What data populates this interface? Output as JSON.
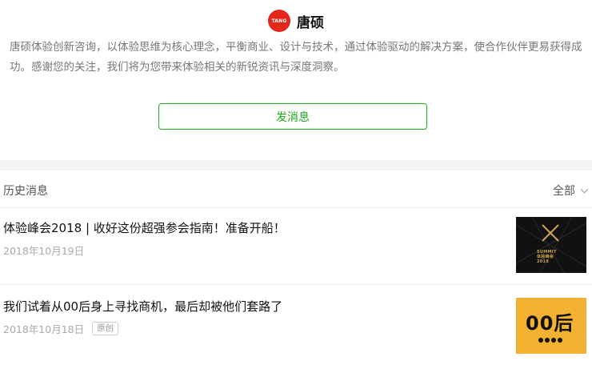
{
  "account": {
    "logo_text": "TANG",
    "name": "唐硕",
    "description": "唐硕体验创新咨询，以体验思维为核心理念，平衡商业、设计与技术，通过体验驱动的解决方案，使合作伙伴更易获得成功。感谢您的关注，我们将为您带来体验相关的新锐资讯与深度洞察。",
    "send_message_label": "发消息"
  },
  "history": {
    "title": "历史消息",
    "filter_label": "全部"
  },
  "articles": [
    {
      "title": "体验峰会2018 | 收好这份超强参会指南！准备开船！",
      "date": "2018年10月19日",
      "thumb_caption": "SUMMIT\n体验峰会\n2018"
    },
    {
      "title": "我们试着从00后身上寻找商机，最后却被他们套路了",
      "date": "2018年10月18日",
      "badge": "原创",
      "thumb_caption": "00后"
    }
  ],
  "colors": {
    "accent": "#1aad19",
    "logo": "#e2271d",
    "thumb2_bg": "#f4b232"
  }
}
